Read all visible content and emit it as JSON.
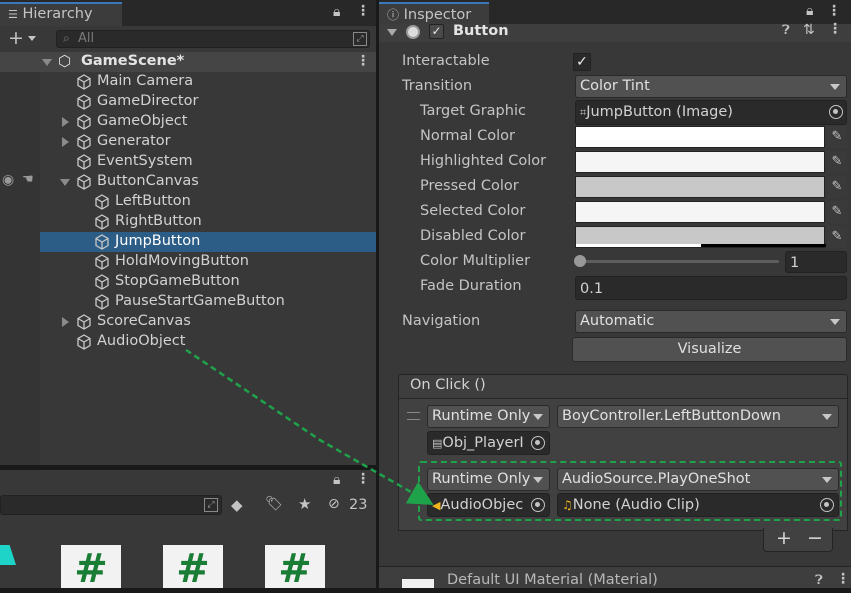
{
  "hierarchy": {
    "tab_label": "Hierarchy",
    "add_label": "+",
    "search_placeholder": "All",
    "scene_name": "GameScene*",
    "items": [
      {
        "label": "Main Camera"
      },
      {
        "label": "GameDirector"
      },
      {
        "label": "GameObject"
      },
      {
        "label": "Generator"
      },
      {
        "label": "EventSystem"
      },
      {
        "label": "ButtonCanvas"
      },
      {
        "label": "LeftButton"
      },
      {
        "label": "RightButton"
      },
      {
        "label": "JumpButton"
      },
      {
        "label": "HoldMovingButton"
      },
      {
        "label": "StopGameButton"
      },
      {
        "label": "PauseStartGameButton"
      },
      {
        "label": "ScoreCanvas"
      },
      {
        "label": "AudioObject"
      }
    ]
  },
  "project": {
    "hidden_count": "23",
    "thumb_glyph": "#"
  },
  "inspector": {
    "tab_label": "Inspector",
    "component_title": "Button",
    "interactable_label": "Interactable",
    "transition_label": "Transition",
    "transition_value": "Color Tint",
    "target_graphic_label": "Target Graphic",
    "target_graphic_value": "JumpButton (Image)",
    "normal_color_label": "Normal Color",
    "highlighted_color_label": "Highlighted Color",
    "pressed_color_label": "Pressed Color",
    "selected_color_label": "Selected Color",
    "disabled_color_label": "Disabled Color",
    "color_multiplier_label": "Color Multiplier",
    "color_multiplier_value": "1",
    "fade_duration_label": "Fade Duration",
    "fade_duration_value": "0.1",
    "navigation_label": "Navigation",
    "navigation_value": "Automatic",
    "visualize_label": "Visualize",
    "onclick_header": "On Click ()",
    "events": [
      {
        "mode": "Runtime Only",
        "function": "BoyController.LeftButtonDown",
        "object": "Obj_PlayerI"
      },
      {
        "mode": "Runtime Only",
        "function": "AudioSource.PlayOneShot",
        "object": "AudioObjec",
        "argument": "None (Audio Clip)"
      }
    ],
    "add_label": "+",
    "remove_label": "−",
    "material_label": "Default UI Material (Material)"
  },
  "colors": {
    "selection": "#2c5d87",
    "annotation": "#1fa34a",
    "normal": "#ffffff",
    "highlighted": "#f5f5f5",
    "pressed": "#c8c8c8",
    "selected": "#f5f5f5",
    "disabled": "#c8c8c8"
  }
}
